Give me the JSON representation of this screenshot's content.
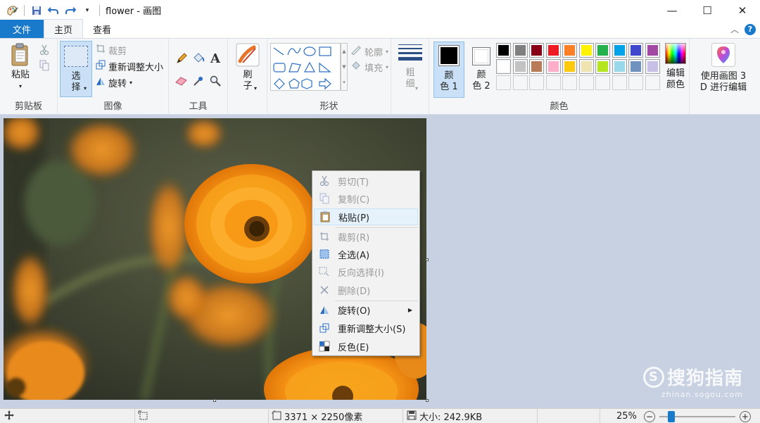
{
  "window": {
    "title": "flower - 画图",
    "minimize_glyph": "—",
    "maximize_glyph": "☐",
    "close_glyph": "✕"
  },
  "tabs": [
    {
      "label": "文件"
    },
    {
      "label": "主页"
    },
    {
      "label": "查看"
    }
  ],
  "ribbon": {
    "clipboard": {
      "paste_label": "粘贴",
      "group_label": "剪贴板"
    },
    "image": {
      "select_label": "选",
      "select_label2": "择",
      "crop_label": "裁剪",
      "resize_label": "重新调整大小",
      "rotate_label": "旋转",
      "group_label": "图像"
    },
    "tools": {
      "group_label": "工具",
      "text_glyph": "A"
    },
    "brush": {
      "label": "刷",
      "label2": "子"
    },
    "shapes": {
      "outline_label": "轮廓",
      "fill_label": "填充",
      "group_label": "形状"
    },
    "size": {
      "label": "粗",
      "label2": "细"
    },
    "colors": {
      "color1_label": "颜",
      "color1_label2": "色 1",
      "color2_label": "颜",
      "color2_label2": "色 2",
      "edit_label": "编辑",
      "edit_label2": "颜色",
      "group_label": "颜色",
      "color1_value": "#000000",
      "color2_value": "#ffffff",
      "palette_row1": [
        "#000000",
        "#7f7f7f",
        "#880015",
        "#ed1c24",
        "#ff7f27",
        "#fff200",
        "#22b14c",
        "#00a2e8",
        "#3f48cc",
        "#a349a4"
      ],
      "palette_row2": [
        "#ffffff",
        "#c3c3c3",
        "#b97a57",
        "#ffaec9",
        "#ffc90e",
        "#efe4b0",
        "#b5e61d",
        "#99d9ea",
        "#7092be",
        "#c8bfe7"
      ]
    },
    "paint3d": {
      "label": "使用画图 3",
      "label2": "D 进行编辑"
    }
  },
  "context_menu": {
    "items": [
      {
        "label": "剪切(T)",
        "icon": "scissors-icon",
        "enabled": false
      },
      {
        "label": "复制(C)",
        "icon": "copy-icon",
        "enabled": false
      },
      {
        "label": "粘贴(P)",
        "icon": "paste-icon",
        "enabled": true
      },
      {
        "label": "裁剪(R)",
        "icon": "crop-icon",
        "enabled": false
      },
      {
        "label": "全选(A)",
        "icon": "select-all-icon",
        "enabled": true
      },
      {
        "label": "反向选择(I)",
        "icon": "invert-selection-icon",
        "enabled": false
      },
      {
        "label": "删除(D)",
        "icon": "delete-icon",
        "enabled": false
      },
      {
        "label": "旋转(O)",
        "icon": "rotate-icon",
        "enabled": true
      },
      {
        "label": "重新调整大小(S)",
        "icon": "resize-icon",
        "enabled": true
      },
      {
        "label": "反色(E)",
        "icon": "invert-color-icon",
        "enabled": true
      }
    ]
  },
  "status": {
    "dimensions": "3371 × 2250像素",
    "size": "大小: 242.9KB",
    "zoom": "25%",
    "zoom_fraction": 0.12
  },
  "watermark": {
    "main": "搜狗指南",
    "sub": "zhinan.sogou.com"
  }
}
